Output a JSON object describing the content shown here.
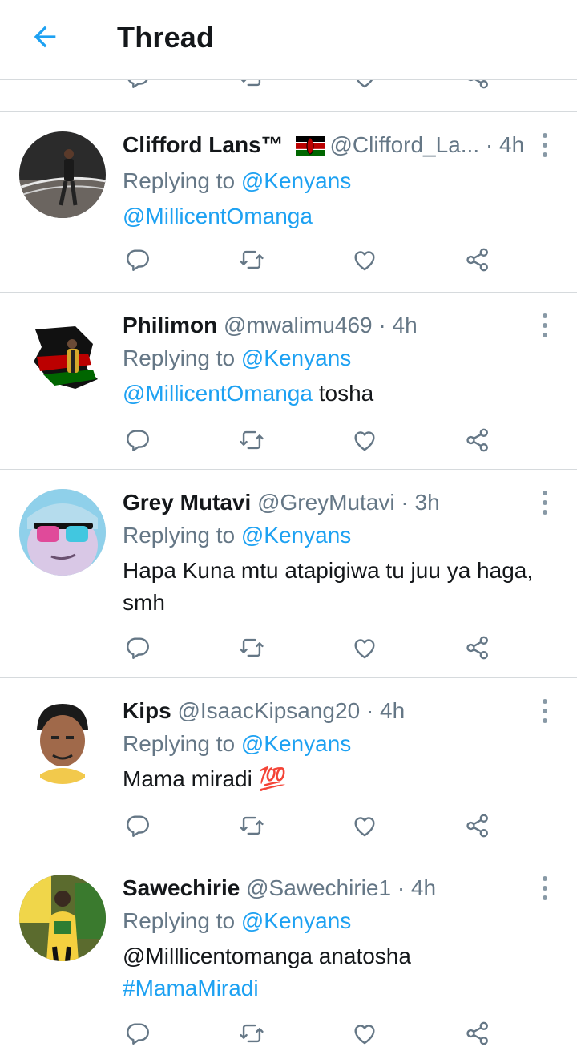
{
  "header": {
    "title": "Thread",
    "back_icon": "arrow-left-icon",
    "accent": "#1da1f2"
  },
  "tweets": [
    {
      "name": "Clifford Lans™",
      "has_flag": true,
      "handle": "@Clifford_La...",
      "time": "· 4h",
      "replying_prefix": "Replying to",
      "replying_to": "@Kenyans",
      "text_mention": "@MillicentOmanga",
      "text": "",
      "text_hashtag": ""
    },
    {
      "name": "Philimon",
      "has_flag": false,
      "handle": "@mwalimu469",
      "time": "· 4h",
      "replying_prefix": "Replying to",
      "replying_to": "@Kenyans",
      "text_mention": "@MillicentOmanga",
      "text": " tosha",
      "text_hashtag": ""
    },
    {
      "name": "Grey Mutavi",
      "has_flag": false,
      "handle": "@GreyMutavi",
      "time": "· 3h",
      "replying_prefix": "Replying to",
      "replying_to": "@Kenyans",
      "text_mention": "",
      "text": "Hapa Kuna mtu atapigiwa tu juu ya haga, smh",
      "text_hashtag": ""
    },
    {
      "name": "Kips",
      "has_flag": false,
      "handle": "@IsaacKipsang20",
      "time": "· 4h",
      "replying_prefix": "Replying to",
      "replying_to": "@Kenyans",
      "text_mention": "",
      "text": "Mama miradi 💯",
      "text_hashtag": ""
    },
    {
      "name": "Sawechirie",
      "has_flag": false,
      "handle": "@Sawechirie1",
      "time": "· 4h",
      "replying_prefix": "Replying to",
      "replying_to": "@Kenyans",
      "text_mention": "",
      "text": "@Milllicentomanga anatosha",
      "text_hashtag": "#MamaMiradi"
    }
  ],
  "action_icons": [
    "reply-icon",
    "retweet-icon",
    "like-icon",
    "share-icon"
  ],
  "colors": {
    "text": "#14171a",
    "secondary": "#657786",
    "link": "#1da1f2",
    "divider": "#d6dadd"
  }
}
